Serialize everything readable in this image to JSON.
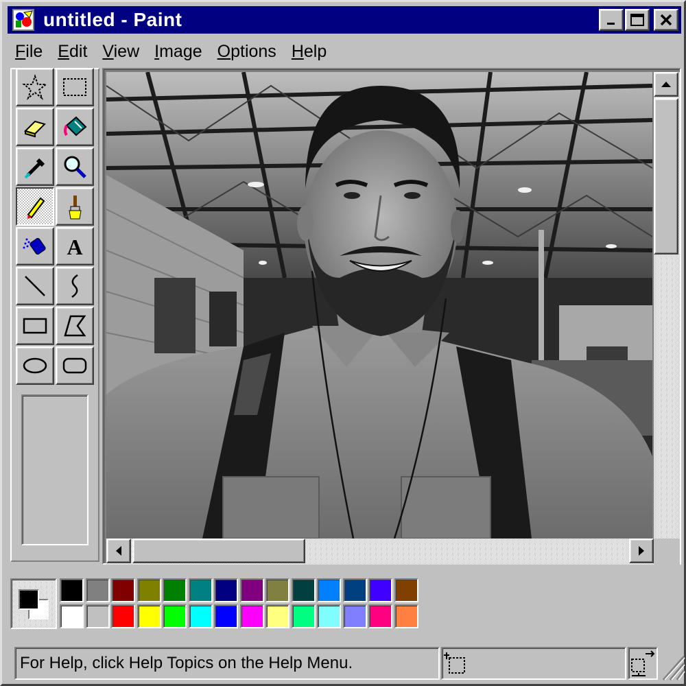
{
  "window": {
    "title": "untitled - Paint",
    "titlebar_color": "#000080",
    "buttons": {
      "minimize": "minimize-icon",
      "maximize": "maximize-icon",
      "close": "close-icon"
    }
  },
  "menu": [
    {
      "label": "File",
      "mnemonic": "F",
      "rest": "ile"
    },
    {
      "label": "Edit",
      "mnemonic": "E",
      "rest": "dit"
    },
    {
      "label": "View",
      "mnemonic": "V",
      "rest": "iew"
    },
    {
      "label": "Image",
      "mnemonic": "I",
      "rest": "mage"
    },
    {
      "label": "Options",
      "mnemonic": "O",
      "rest": "ptions"
    },
    {
      "label": "Help",
      "mnemonic": "H",
      "rest": "elp"
    }
  ],
  "tools": [
    {
      "id": "free-form-select",
      "icon": "star-select-icon"
    },
    {
      "id": "select",
      "icon": "rect-select-icon"
    },
    {
      "id": "eraser",
      "icon": "eraser-icon"
    },
    {
      "id": "fill",
      "icon": "paint-bucket-icon"
    },
    {
      "id": "pick-color",
      "icon": "eyedropper-icon"
    },
    {
      "id": "magnifier",
      "icon": "magnifier-icon"
    },
    {
      "id": "pencil",
      "icon": "pencil-icon",
      "active": true
    },
    {
      "id": "brush",
      "icon": "brush-icon"
    },
    {
      "id": "airbrush",
      "icon": "airbrush-icon"
    },
    {
      "id": "text",
      "icon": "text-icon",
      "label": "A"
    },
    {
      "id": "line",
      "icon": "line-icon"
    },
    {
      "id": "curve",
      "icon": "curve-icon"
    },
    {
      "id": "rectangle",
      "icon": "rectangle-icon"
    },
    {
      "id": "polygon",
      "icon": "polygon-icon"
    },
    {
      "id": "ellipse",
      "icon": "ellipse-icon"
    },
    {
      "id": "rounded-rectangle",
      "icon": "rounded-rectangle-icon"
    }
  ],
  "palette": {
    "foreground": "#000000",
    "background": "#ffffff",
    "top_row": [
      "#000000",
      "#808080",
      "#800000",
      "#808000",
      "#008000",
      "#008080",
      "#000080",
      "#800080",
      "#808040",
      "#004040",
      "#0080ff",
      "#004080",
      "#4000ff",
      "#804000"
    ],
    "bottom_row": [
      "#ffffff",
      "#c0c0c0",
      "#ff0000",
      "#ffff00",
      "#00ff00",
      "#00ffff",
      "#0000ff",
      "#ff00ff",
      "#ffff80",
      "#00ff80",
      "#80ffff",
      "#8080ff",
      "#ff0080",
      "#ff8040"
    ]
  },
  "status": {
    "help_text": "For Help, click Help Topics on the Help Menu.",
    "position_icon": "cursor-position-icon",
    "size_icon": "selection-size-icon"
  },
  "canvas": {
    "image": "grayscale selfie photo"
  }
}
